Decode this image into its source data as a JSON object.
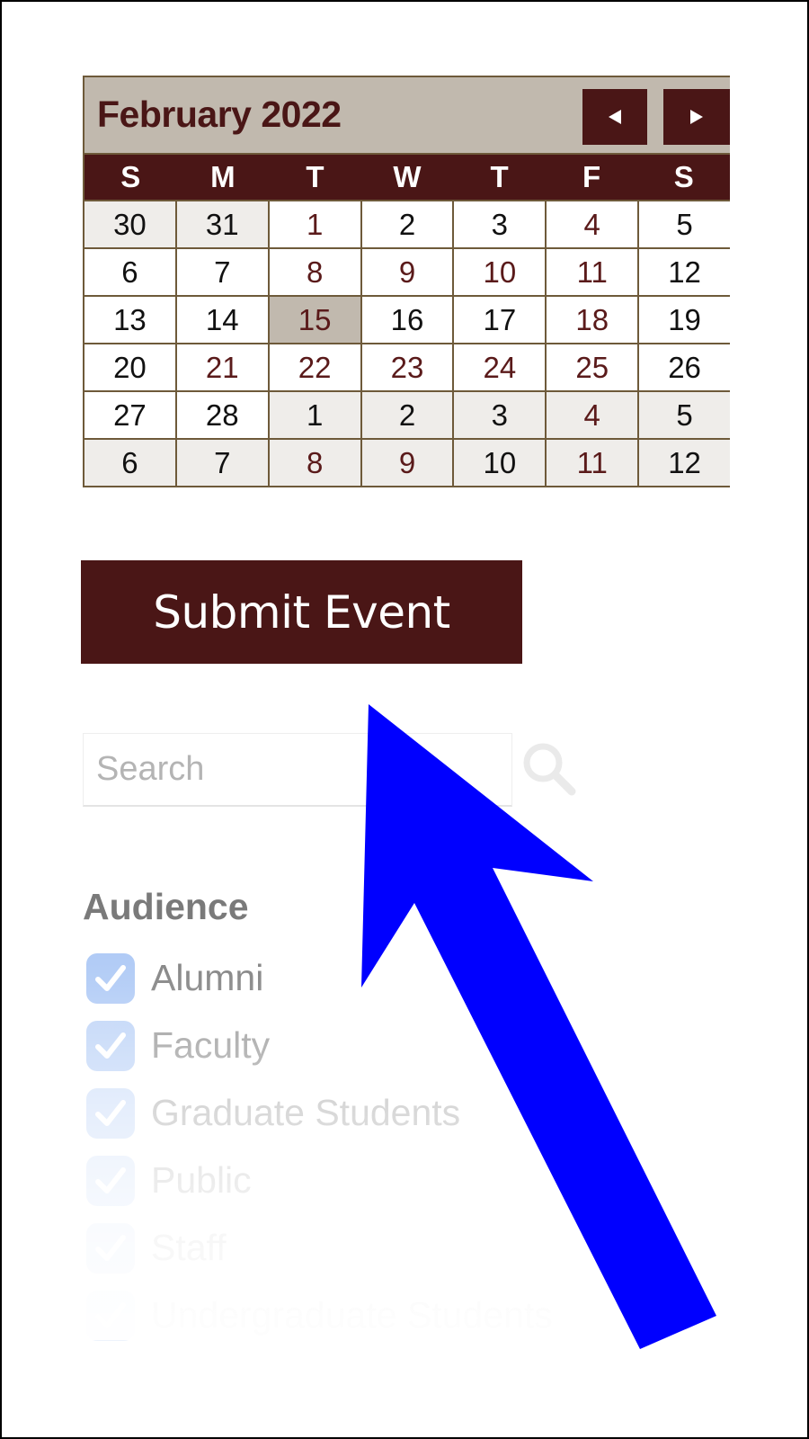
{
  "calendar": {
    "title": "February 2022",
    "prev_icon": "triangle-left-icon",
    "next_icon": "triangle-right-icon",
    "weekdays": [
      "S",
      "M",
      "T",
      "W",
      "T",
      "F",
      "S"
    ],
    "today": 15,
    "weeks": [
      [
        {
          "d": "30",
          "other": true,
          "event": false
        },
        {
          "d": "31",
          "other": true,
          "event": false
        },
        {
          "d": "1",
          "other": false,
          "event": true
        },
        {
          "d": "2",
          "other": false,
          "event": false
        },
        {
          "d": "3",
          "other": false,
          "event": false
        },
        {
          "d": "4",
          "other": false,
          "event": true
        },
        {
          "d": "5",
          "other": false,
          "event": false
        }
      ],
      [
        {
          "d": "6",
          "other": false,
          "event": false
        },
        {
          "d": "7",
          "other": false,
          "event": false
        },
        {
          "d": "8",
          "other": false,
          "event": true
        },
        {
          "d": "9",
          "other": false,
          "event": true
        },
        {
          "d": "10",
          "other": false,
          "event": true
        },
        {
          "d": "11",
          "other": false,
          "event": true
        },
        {
          "d": "12",
          "other": false,
          "event": false
        }
      ],
      [
        {
          "d": "13",
          "other": false,
          "event": false
        },
        {
          "d": "14",
          "other": false,
          "event": false
        },
        {
          "d": "15",
          "other": false,
          "event": true,
          "today": true
        },
        {
          "d": "16",
          "other": false,
          "event": false
        },
        {
          "d": "17",
          "other": false,
          "event": false
        },
        {
          "d": "18",
          "other": false,
          "event": true
        },
        {
          "d": "19",
          "other": false,
          "event": false
        }
      ],
      [
        {
          "d": "20",
          "other": false,
          "event": false
        },
        {
          "d": "21",
          "other": false,
          "event": true
        },
        {
          "d": "22",
          "other": false,
          "event": true
        },
        {
          "d": "23",
          "other": false,
          "event": true
        },
        {
          "d": "24",
          "other": false,
          "event": true
        },
        {
          "d": "25",
          "other": false,
          "event": true
        },
        {
          "d": "26",
          "other": false,
          "event": false
        }
      ],
      [
        {
          "d": "27",
          "other": false,
          "event": false
        },
        {
          "d": "28",
          "other": false,
          "event": false
        },
        {
          "d": "1",
          "other": true,
          "event": false
        },
        {
          "d": "2",
          "other": true,
          "event": false
        },
        {
          "d": "3",
          "other": true,
          "event": false
        },
        {
          "d": "4",
          "other": true,
          "event": true
        },
        {
          "d": "5",
          "other": true,
          "event": false
        }
      ],
      [
        {
          "d": "6",
          "other": true,
          "event": false
        },
        {
          "d": "7",
          "other": true,
          "event": false
        },
        {
          "d": "8",
          "other": true,
          "event": true
        },
        {
          "d": "9",
          "other": true,
          "event": true
        },
        {
          "d": "10",
          "other": true,
          "event": false
        },
        {
          "d": "11",
          "other": true,
          "event": true
        },
        {
          "d": "12",
          "other": true,
          "event": false
        }
      ]
    ]
  },
  "submit": {
    "label": "Submit Event"
  },
  "search": {
    "placeholder": "Search",
    "value": "",
    "icon": "magnifier-icon"
  },
  "audience": {
    "title": "Audience",
    "items": [
      {
        "label": "Alumni",
        "checked": true
      },
      {
        "label": "Faculty",
        "checked": true
      },
      {
        "label": "Graduate Students",
        "checked": true
      },
      {
        "label": "Public",
        "checked": true
      },
      {
        "label": "Staff",
        "checked": true
      },
      {
        "label": "Undergraduate Students",
        "checked": true
      }
    ]
  },
  "annotation": {
    "type": "arrow",
    "color": "#0000ff",
    "points_to": "submit-event-button"
  },
  "colors": {
    "brand": "#4a1616",
    "header_bg": "#c1b9ae",
    "grid_border": "#6e5a3a",
    "other_month_bg": "#efedea",
    "event_text": "#5a1a1a",
    "checkbox": "#a9c6f5"
  }
}
